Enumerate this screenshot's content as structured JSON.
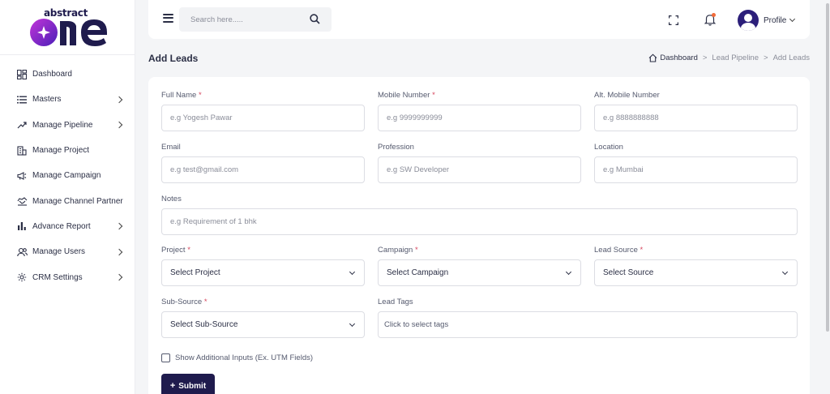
{
  "brand": {
    "word_top": "abstract",
    "word_main": "one"
  },
  "sidebar": {
    "items": [
      {
        "label": "Dashboard",
        "icon": "dashboard-icon",
        "has_submenu": false
      },
      {
        "label": "Masters",
        "icon": "list-icon",
        "has_submenu": true
      },
      {
        "label": "Manage Pipeline",
        "icon": "pipeline-icon",
        "has_submenu": true
      },
      {
        "label": "Manage Project",
        "icon": "building-icon",
        "has_submenu": false
      },
      {
        "label": "Manage Campaign",
        "icon": "megaphone-icon",
        "has_submenu": false
      },
      {
        "label": "Manage Channel Partner",
        "icon": "handshake-icon",
        "has_submenu": false
      },
      {
        "label": "Advance Report",
        "icon": "bar-chart-icon",
        "has_submenu": true
      },
      {
        "label": "Manage Users",
        "icon": "users-icon",
        "has_submenu": true
      },
      {
        "label": "CRM Settings",
        "icon": "gear-icon",
        "has_submenu": true
      }
    ]
  },
  "topbar": {
    "search_placeholder": "Search here.....",
    "profile_label": "Profile"
  },
  "page": {
    "title": "Add Leads",
    "breadcrumb": [
      "Dashboard",
      "Lead Pipeline",
      "Add Leads"
    ]
  },
  "form": {
    "full_name": {
      "label": "Full Name",
      "required": "*",
      "placeholder": "e.g Yogesh Pawar"
    },
    "mobile": {
      "label": "Mobile Number",
      "required": "*",
      "placeholder": "e.g 9999999999"
    },
    "alt_mobile": {
      "label": "Alt. Mobile Number",
      "placeholder": "e.g 8888888888"
    },
    "email": {
      "label": "Email",
      "placeholder": "e.g test@gmail.com"
    },
    "profession": {
      "label": "Profession",
      "placeholder": "e.g SW Developer"
    },
    "location": {
      "label": "Location",
      "placeholder": "e.g Mumbai"
    },
    "notes": {
      "label": "Notes",
      "placeholder": "e.g Requirement of 1 bhk"
    },
    "project": {
      "label": "Project",
      "required": "*",
      "value": "Select Project"
    },
    "campaign": {
      "label": "Campaign",
      "required": "*",
      "value": "Select Campaign"
    },
    "lead_source": {
      "label": "Lead Source",
      "required": "*",
      "value": "Select Source"
    },
    "sub_source": {
      "label": "Sub-Source",
      "required": "*",
      "value": "Select Sub-Source"
    },
    "lead_tags": {
      "label": "Lead Tags",
      "placeholder": "Click to select tags"
    },
    "additional_inputs_label": "Show Additional Inputs (Ex. UTM Fields)",
    "submit_label": "Submit"
  },
  "colors": {
    "brand_dark": "#1f1b4d",
    "required_red": "#d6455d",
    "notification_dot": "#f26b3a",
    "page_bg": "#f4f5f7"
  }
}
